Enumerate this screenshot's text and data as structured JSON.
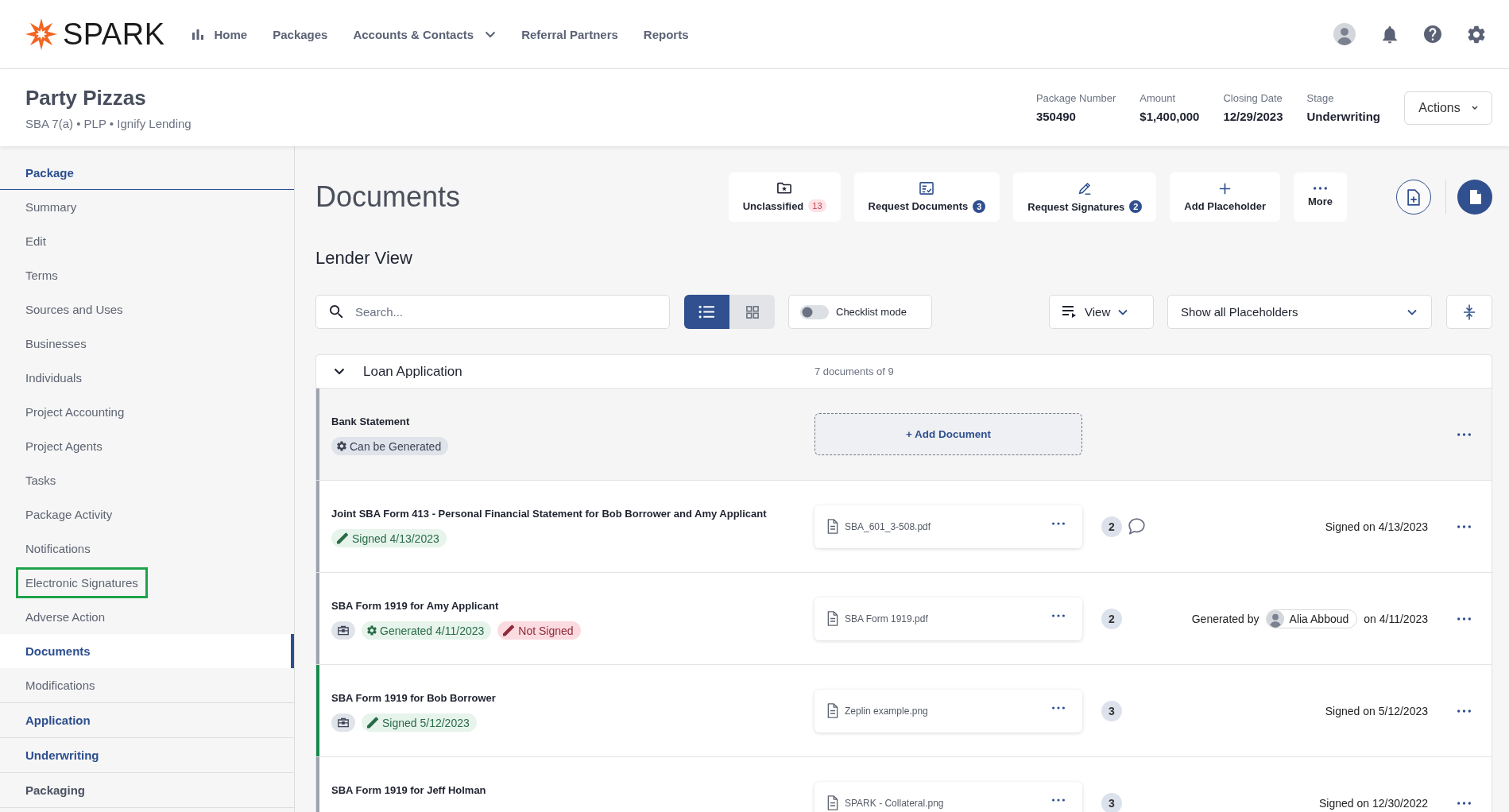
{
  "logo": {
    "text": "SPARK"
  },
  "nav": [
    {
      "label": "Home",
      "dropdown": false
    },
    {
      "label": "Packages",
      "dropdown": false
    },
    {
      "label": "Accounts & Contacts",
      "dropdown": true
    },
    {
      "label": "Referral Partners",
      "dropdown": false
    },
    {
      "label": "Reports",
      "dropdown": false
    }
  ],
  "package": {
    "name": "Party Pizzas",
    "subtitle": "SBA 7(a) • PLP • Ignify Lending",
    "meta": [
      {
        "label": "Package Number",
        "value": "350490"
      },
      {
        "label": "Amount",
        "value": "$1,400,000"
      },
      {
        "label": "Closing Date",
        "value": "12/29/2023"
      },
      {
        "label": "Stage",
        "value": "Underwriting"
      }
    ],
    "actions_button": "Actions"
  },
  "sidebar": {
    "sections": [
      {
        "label": "Package",
        "expanded": true,
        "disabled": false,
        "items": [
          {
            "label": "Summary",
            "selected": false,
            "outlined": false
          },
          {
            "label": "Edit",
            "selected": false,
            "outlined": false
          },
          {
            "label": "Terms",
            "selected": false,
            "outlined": false
          },
          {
            "label": "Sources and Uses",
            "selected": false,
            "outlined": false
          },
          {
            "label": "Businesses",
            "selected": false,
            "outlined": false
          },
          {
            "label": "Individuals",
            "selected": false,
            "outlined": false
          },
          {
            "label": "Project Accounting",
            "selected": false,
            "outlined": false
          },
          {
            "label": "Project Agents",
            "selected": false,
            "outlined": false
          },
          {
            "label": "Tasks",
            "selected": false,
            "outlined": false
          },
          {
            "label": "Package Activity",
            "selected": false,
            "outlined": false
          },
          {
            "label": "Notifications",
            "selected": false,
            "outlined": false
          },
          {
            "label": "Electronic Signatures",
            "selected": false,
            "outlined": true
          },
          {
            "label": "Adverse Action",
            "selected": false,
            "outlined": false
          },
          {
            "label": "Documents",
            "selected": true,
            "outlined": false
          },
          {
            "label": "Modifications",
            "selected": false,
            "outlined": false
          }
        ]
      },
      {
        "label": "Application",
        "expanded": false,
        "disabled": false
      },
      {
        "label": "Underwriting",
        "expanded": false,
        "disabled": false
      },
      {
        "label": "Packaging",
        "expanded": false,
        "disabled": true
      }
    ]
  },
  "page": {
    "title": "Documents",
    "subtitle": "Lender View"
  },
  "toolbar_buttons": [
    {
      "label": "Unclassified",
      "badge": {
        "text": "13",
        "kind": "alert"
      }
    },
    {
      "label": "Request Documents",
      "badge": {
        "text": "3",
        "kind": "count"
      }
    },
    {
      "label": "Request Signatures",
      "badge": {
        "text": "2",
        "kind": "count"
      }
    },
    {
      "label": "Add Placeholder"
    },
    {
      "label": "More"
    }
  ],
  "filters": {
    "search": {
      "placeholder": "Search..."
    },
    "layouts": [
      {
        "kind": "list",
        "selected": true
      },
      {
        "kind": "grid",
        "selected": false
      }
    ],
    "checklist": {
      "label": "Checklist mode",
      "on": false
    },
    "view": {
      "label": "View"
    },
    "placeholder_filter": {
      "value": "Show all Placeholders"
    }
  },
  "groups": [
    {
      "title": "Loan Application",
      "expanded": true,
      "count": "7 documents of 9",
      "rows": [
        {
          "kind": "placeholder",
          "title": "Bank Statement",
          "color": "#9ea3ad",
          "tags": [
            {
              "kind": "generatable",
              "text": "Can be Generated"
            }
          ],
          "action": "+ Add Document"
        },
        {
          "kind": "document",
          "title": "Joint SBA Form 413 - Personal Financial Statement for Bob Borrower and Amy Applicant",
          "color": "#9ea3ad",
          "tags": [
            {
              "kind": "signed",
              "text": "Signed 4/13/2023"
            }
          ],
          "file": "SBA_601_3-508.pdf",
          "versions": "2",
          "has_comment": true,
          "status": {
            "kind": "signed",
            "text": "Signed on 4/13/2023"
          }
        },
        {
          "kind": "document",
          "title": "SBA Form 1919 for Amy Applicant",
          "color": "#9ea3ad",
          "tags": [
            {
              "kind": "business"
            },
            {
              "kind": "generated",
              "text": "Generated 4/11/2023"
            },
            {
              "kind": "unsigned",
              "text": "Not Signed"
            }
          ],
          "file": "SBA Form 1919.pdf",
          "versions": "2",
          "has_comment": false,
          "status": {
            "kind": "generated",
            "prefix": "Generated by",
            "user": "Alia Abboud",
            "suffix": "on 4/11/2023"
          }
        },
        {
          "kind": "document",
          "title": "SBA Form 1919 for Bob Borrower",
          "color": "#168a4c",
          "tags": [
            {
              "kind": "business"
            },
            {
              "kind": "signed",
              "text": "Signed 5/12/2023"
            }
          ],
          "file": "Zeplin example.png",
          "versions": "3",
          "has_comment": false,
          "status": {
            "kind": "signed",
            "text": "Signed on 5/12/2023"
          }
        },
        {
          "kind": "document",
          "title": "SBA Form 1919 for Jeff Holman",
          "color": "#9ea3ad",
          "file": "SPARK - Collateral.png",
          "versions": "3",
          "has_comment": false,
          "status": {
            "kind": "signed",
            "text": "Signed on 12/30/2022"
          }
        }
      ]
    }
  ]
}
